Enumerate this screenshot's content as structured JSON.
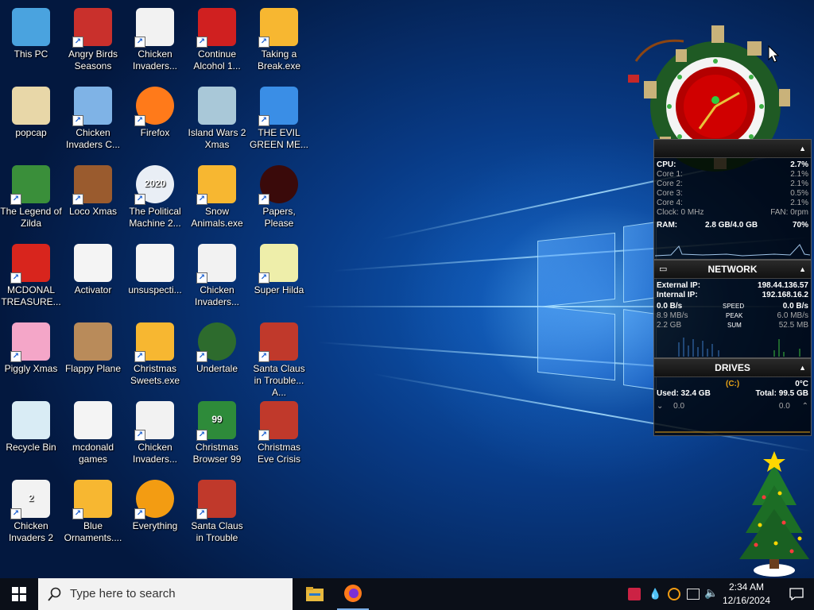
{
  "desktop": {
    "icons": [
      {
        "label": "This PC",
        "glyph": "monitor-icon",
        "shortcut": false
      },
      {
        "label": "popcap",
        "glyph": "folder-icon",
        "shortcut": false
      },
      {
        "label": "The Legend of Zilda",
        "glyph": "game-icon",
        "shortcut": true
      },
      {
        "label": "MCDONAL TREASURE...",
        "glyph": "mcdonalds-icon",
        "shortcut": true
      },
      {
        "label": "Piggly Xmas",
        "glyph": "pig-icon",
        "shortcut": true
      },
      {
        "label": "Recycle Bin",
        "glyph": "recycle-bin-icon",
        "shortcut": false
      },
      {
        "label": "Chicken Invaders 2",
        "glyph": "chicken-icon",
        "shortcut": true
      },
      {
        "label": "Angry Birds Seasons",
        "glyph": "angry-bird-icon",
        "shortcut": true
      },
      {
        "label": "Chicken Invaders C...",
        "glyph": "snowman-icon",
        "shortcut": true
      },
      {
        "label": "Loco Xmas",
        "glyph": "bear-icon",
        "shortcut": true
      },
      {
        "label": "Activator",
        "glyph": "file-icon",
        "shortcut": false
      },
      {
        "label": "Flappy Plane",
        "glyph": "plane-icon",
        "shortcut": false
      },
      {
        "label": "mcdonald games",
        "glyph": "file-icon",
        "shortcut": false
      },
      {
        "label": "Blue Ornaments....",
        "glyph": "star-icon",
        "shortcut": true
      },
      {
        "label": "Chicken Invaders...",
        "glyph": "chicken-icon",
        "shortcut": true
      },
      {
        "label": "Firefox",
        "glyph": "firefox-icon",
        "shortcut": true
      },
      {
        "label": "The Political Machine 2...",
        "glyph": "political-icon",
        "shortcut": true
      },
      {
        "label": "unsuspecti...",
        "glyph": "file-icon",
        "shortcut": false
      },
      {
        "label": "Christmas Sweets.exe",
        "glyph": "star-icon",
        "shortcut": true
      },
      {
        "label": "Chicken Invaders...",
        "glyph": "chicken-icon",
        "shortcut": true
      },
      {
        "label": "Everything",
        "glyph": "magnifier-icon",
        "shortcut": true
      },
      {
        "label": "Continue Alcohol 1...",
        "glyph": "alcohol-icon",
        "shortcut": true
      },
      {
        "label": "Island Wars 2 Xmas",
        "glyph": "island-icon",
        "shortcut": false
      },
      {
        "label": "Snow Animals.exe",
        "glyph": "star-icon",
        "shortcut": true
      },
      {
        "label": "Chicken Invaders...",
        "glyph": "chicken-icon",
        "shortcut": true
      },
      {
        "label": "Undertale",
        "glyph": "undertale-icon",
        "shortcut": true
      },
      {
        "label": "Christmas Browser 99",
        "glyph": "xmas-tree-icon",
        "shortcut": true
      },
      {
        "label": "Santa Claus in Trouble",
        "glyph": "santa-icon",
        "shortcut": true
      },
      {
        "label": "Taking a Break.exe",
        "glyph": "star-icon",
        "shortcut": true
      },
      {
        "label": "THE EVIL GREEN ME...",
        "glyph": "messenger-icon",
        "shortcut": true
      },
      {
        "label": "Papers, Please",
        "glyph": "papers-please-icon",
        "shortcut": true
      },
      {
        "label": "Super Hilda",
        "glyph": "pixel-dog-icon",
        "shortcut": true
      },
      {
        "label": "Santa Claus in Trouble... A...",
        "glyph": "santa-icon",
        "shortcut": true
      },
      {
        "label": "Christmas Eve Crisis",
        "glyph": "santa-icon",
        "shortcut": true
      }
    ],
    "badges": {
      "chicken2": "2",
      "xmas99": "99",
      "political": "2020"
    }
  },
  "system_monitor": {
    "cpu_label": "CPU:",
    "cpu_value": "2.7%",
    "cores": [
      {
        "label": "Core 1:",
        "value": "2.1%"
      },
      {
        "label": "Core 2:",
        "value": "2.1%"
      },
      {
        "label": "Core 3:",
        "value": "0.5%"
      },
      {
        "label": "Core 4:",
        "value": "2.1%"
      }
    ],
    "clock_label": "Clock: 0 MHz",
    "fan_label": "FAN: 0rpm",
    "ram_label": "RAM:",
    "ram_amount": "2.8 GB/4.0 GB",
    "ram_percent": "70%"
  },
  "network": {
    "title": "NETWORK",
    "external_label": "External IP:",
    "external_ip": "198.44.136.57",
    "internal_label": "Internal IP:",
    "internal_ip": "192.168.16.2",
    "speed_left": "0.0 B/s",
    "speed_label": "SPEED",
    "speed_right": "0.0 B/s",
    "peak_left": "8.9 MB/s",
    "peak_label": "PEAK",
    "peak_right": "6.0 MB/s",
    "sum_left": "2.2 GB",
    "sum_label": "SUM",
    "sum_right": "52.5 MB"
  },
  "drives": {
    "title": "DRIVES",
    "drive_letter": "(C:)",
    "temp": "0°C",
    "used": "Used: 32.4 GB",
    "total": "Total: 99.5 GB",
    "read": "0.0",
    "write": "0.0"
  },
  "taskbar": {
    "search_placeholder": "Type here to search",
    "time": "2:34 AM",
    "date": "12/16/2024"
  },
  "colors": {
    "accent": "#0078d7",
    "taskbar": "#0b0f18",
    "wallpaper": "#0a4fa8"
  }
}
